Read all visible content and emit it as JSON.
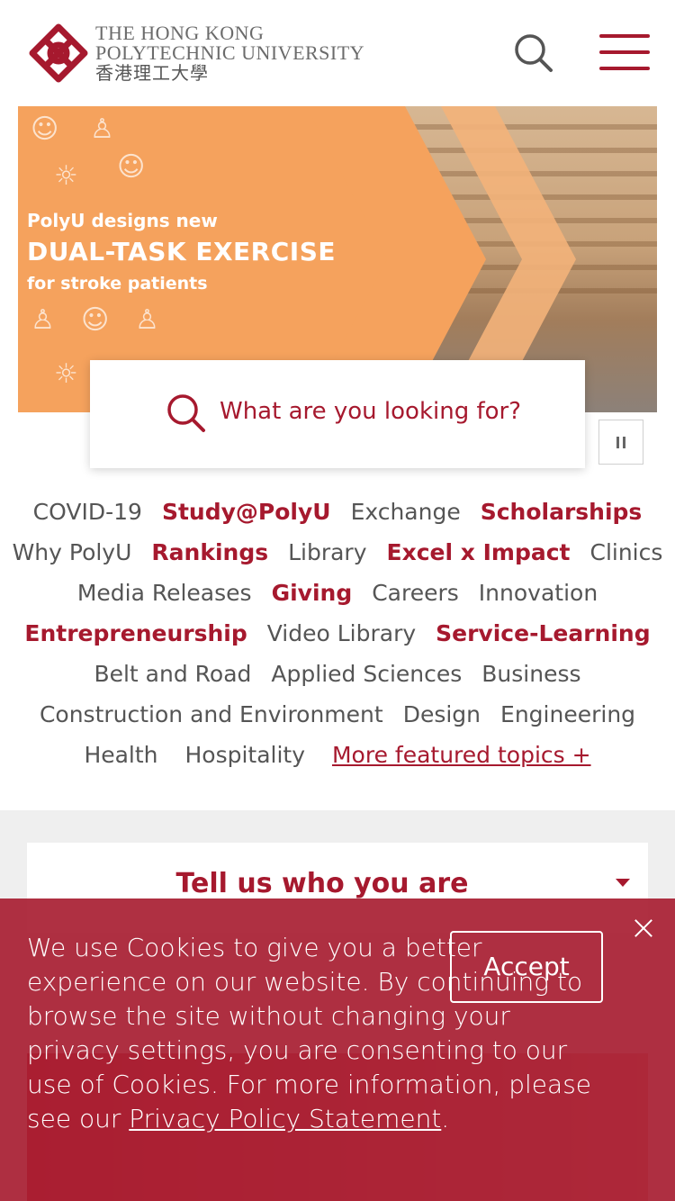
{
  "header": {
    "logo_line1": "The Hong Kong",
    "logo_line2": "Polytechnic University",
    "logo_line3": "香港理工大學",
    "search_icon": "search-icon",
    "menu_icon": "hamburger-menu-icon"
  },
  "hero": {
    "line1": "PolyU designs new",
    "line2": "DUAL-TASK EXERCISE",
    "line3": "for stroke patients"
  },
  "search": {
    "placeholder": "What are you looking for?"
  },
  "carousel": {
    "pause_icon": "pause-icon"
  },
  "topics": {
    "rows": [
      [
        {
          "label": "COVID-19",
          "bold": false
        },
        {
          "label": "Study@PolyU",
          "bold": true
        },
        {
          "label": "Exchange",
          "bold": false
        },
        {
          "label": "Scholarships",
          "bold": true
        }
      ],
      [
        {
          "label": "Why PolyU",
          "bold": false
        },
        {
          "label": "Rankings",
          "bold": true
        },
        {
          "label": "Library",
          "bold": false
        },
        {
          "label": "Excel x Impact",
          "bold": true
        },
        {
          "label": "Clinics",
          "bold": false
        }
      ],
      [
        {
          "label": "Media Releases",
          "bold": false
        },
        {
          "label": "Giving",
          "bold": true
        },
        {
          "label": "Careers",
          "bold": false
        },
        {
          "label": "Innovation",
          "bold": false
        }
      ],
      [
        {
          "label": "Entrepreneurship",
          "bold": true
        },
        {
          "label": "Video Library",
          "bold": false
        },
        {
          "label": "Service-Learning",
          "bold": true
        }
      ],
      [
        {
          "label": "Belt and Road",
          "bold": false
        },
        {
          "label": "Applied Sciences",
          "bold": false
        },
        {
          "label": "Business",
          "bold": false
        }
      ],
      [
        {
          "label": "Construction and Environment",
          "bold": false
        },
        {
          "label": "Design",
          "bold": false
        },
        {
          "label": "Engineering",
          "bold": false
        }
      ]
    ],
    "last_row": [
      {
        "label": "Health"
      },
      {
        "label": "Hospitality"
      }
    ],
    "more_label": "More featured topics +"
  },
  "audience": {
    "label": "Tell us who you are"
  },
  "cookie": {
    "text": "We use Cookies to give you a better experience on our website. By continuing to browse the site without changing your privacy settings, you are consenting to our use of Cookies. For more information, please see our ",
    "link": "Privacy Policy Statement",
    "end": ".",
    "accept": "Accept"
  },
  "colors": {
    "brand": "#a6192e",
    "hero_orange": "#f5a25d"
  }
}
